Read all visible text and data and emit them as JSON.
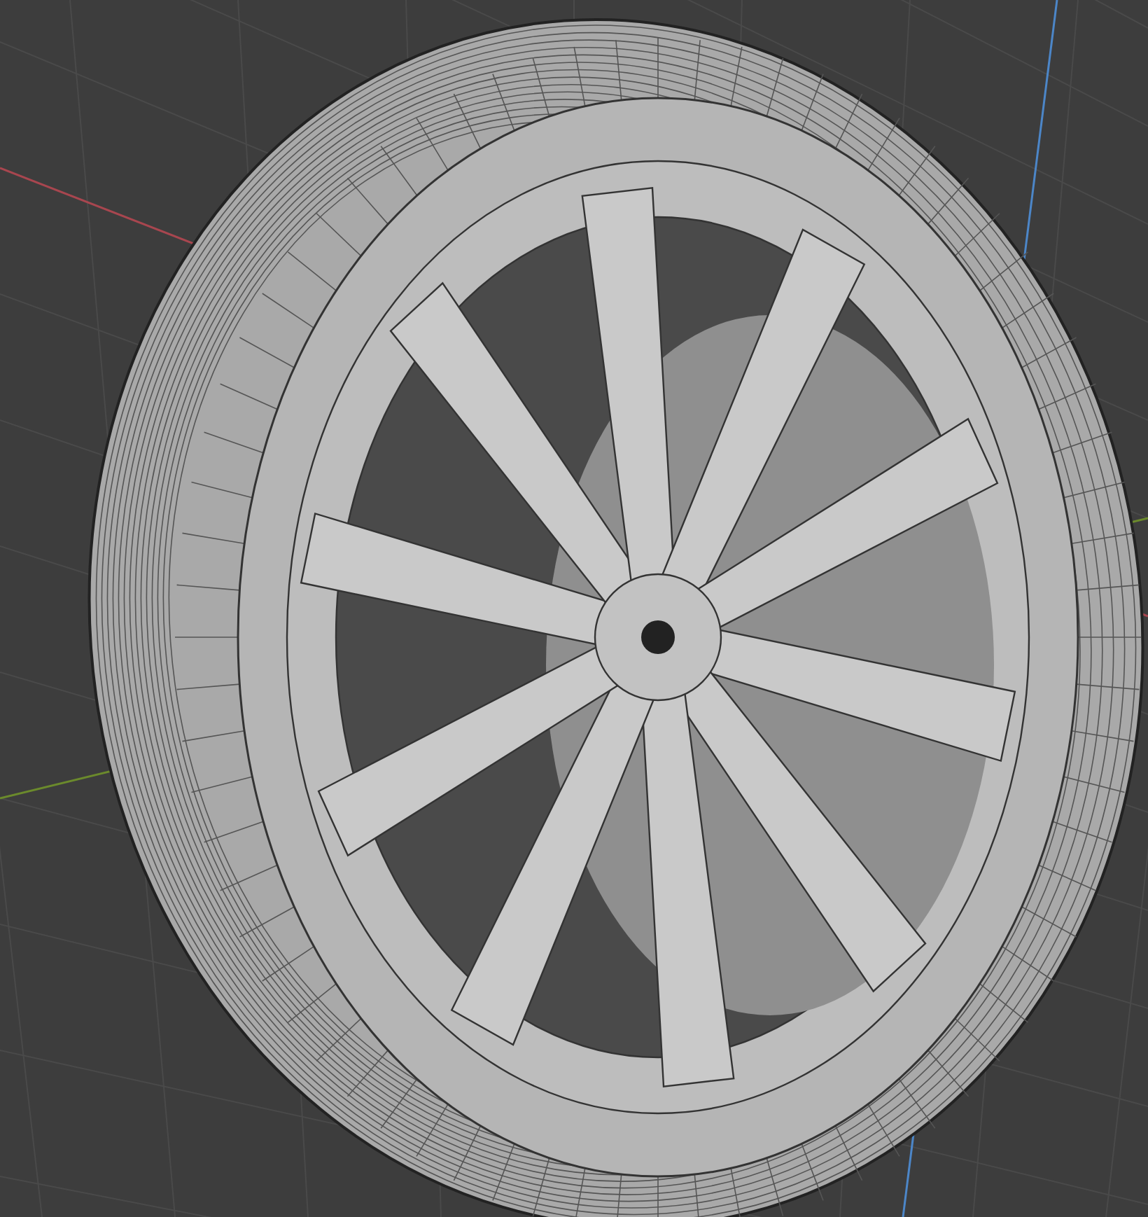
{
  "viewport": {
    "grid": true,
    "axes": [
      {
        "kind": "x",
        "color": "#a8464f"
      },
      {
        "kind": "y",
        "color": "#6b8a2c"
      },
      {
        "kind": "z",
        "color": "#4c86c8"
      }
    ],
    "model": {
      "wireframe": true
    }
  }
}
